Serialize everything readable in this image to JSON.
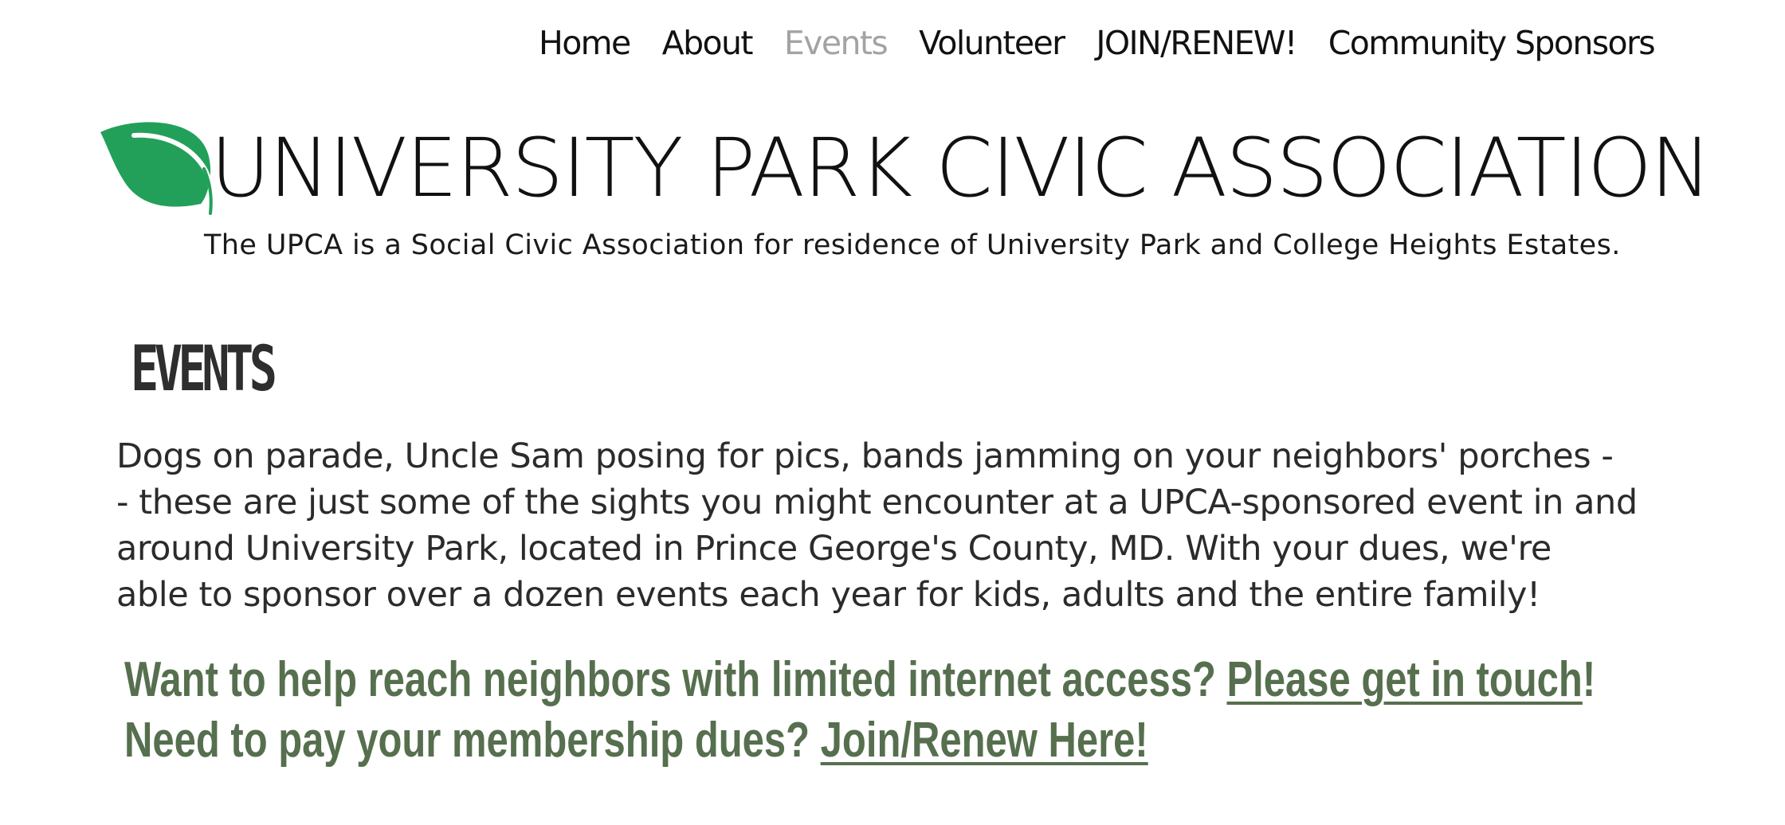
{
  "nav": {
    "items": [
      {
        "label": "Home",
        "active": false
      },
      {
        "label": "About",
        "active": false
      },
      {
        "label": "Events",
        "active": true
      },
      {
        "label": "Volunteer",
        "active": false
      },
      {
        "label": "JOIN/RENEW!",
        "active": false
      },
      {
        "label": "Community Sponsors",
        "active": false
      }
    ]
  },
  "header": {
    "title": "UNIVERSITY PARK CIVIC ASSOCIATION",
    "tagline": "The UPCA is a Social Civic Association for residence of University Park and College Heights Estates.",
    "logo_icon": "green-leaf-icon"
  },
  "events": {
    "heading": "EVENTS",
    "body_lines": [
      "Dogs on parade, Uncle Sam posing for pics, bands jamming on your neighbors' porches -",
      "- these are just some of the sights you might encounter at a UPCA-sponsored event in and",
      "around University Park, located in Prince George's County, MD. With your dues, we're",
      "able to sponsor over a dozen events each year for kids, adults and the entire family!"
    ],
    "cta_internet": {
      "text": "Want to help reach neighbors with limited internet access? ",
      "link": "Please get in touch",
      "suffix": "!"
    },
    "cta_dues": {
      "text": "Need to pay your membership dues? ",
      "link": "Join/Renew Here!"
    }
  },
  "colors": {
    "accent_green": "#566f4e",
    "leaf_green": "#22a05a",
    "nav_active": "#a3a3a3",
    "text": "#111111"
  }
}
